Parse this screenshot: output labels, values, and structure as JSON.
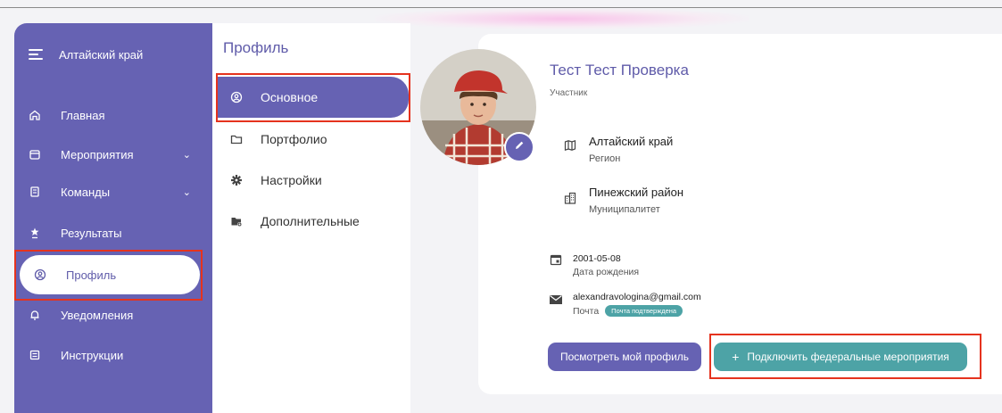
{
  "sidebar": {
    "region": "Алтайский край",
    "items": [
      {
        "label": "Главная",
        "icon": "home-icon"
      },
      {
        "label": "Мероприятия",
        "icon": "calendar-icon"
      },
      {
        "label": "Команды",
        "icon": "document-icon"
      },
      {
        "label": "Результаты",
        "icon": "trophy-icon"
      },
      {
        "label": "Профиль",
        "icon": "profile-icon"
      },
      {
        "label": "Уведомления",
        "icon": "bell-icon"
      },
      {
        "label": "Инструкции",
        "icon": "list-icon"
      }
    ]
  },
  "submenu": {
    "title": "Профиль",
    "items": [
      {
        "label": "Основное",
        "icon": "user-circle-icon"
      },
      {
        "label": "Портфолио",
        "icon": "folder-icon"
      },
      {
        "label": "Настройки",
        "icon": "gear-icon"
      },
      {
        "label": "Дополнительные",
        "icon": "folder-settings-icon"
      }
    ]
  },
  "profile": {
    "name": "Тест Тест Проверка",
    "role": "Участник",
    "region": {
      "value": "Алтайский край",
      "label": "Регион"
    },
    "municipality": {
      "value": "Пинежский район",
      "label": "Муниципалитет"
    },
    "birthdate": {
      "value": "2001-05-08",
      "label": "Дата рождения"
    },
    "email": {
      "value": "alexandravologina@gmail.com",
      "label": "Почта",
      "badge": "Почта подтверждена"
    }
  },
  "buttons": {
    "view_profile": "Посмотреть мой профиль",
    "connect_federal": "Подключить федеральные мероприятия"
  },
  "colors": {
    "accent": "#6662b3",
    "teal": "#4da3a6",
    "highlight": "#e5331e"
  }
}
